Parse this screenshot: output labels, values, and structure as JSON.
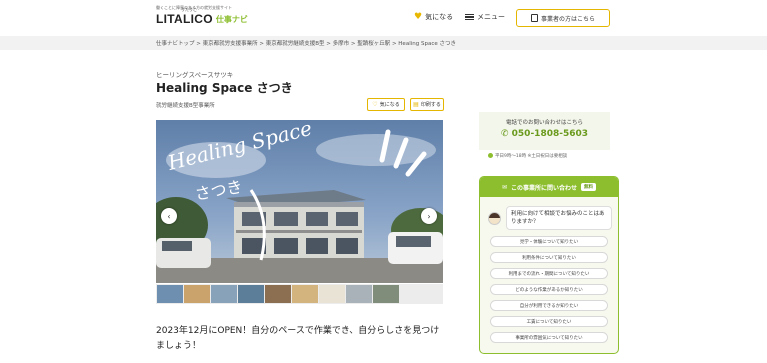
{
  "header": {
    "tagline": "働くことに障害のある方の就労支援サイト",
    "logo_main": "LITALICO",
    "logo_ruby": "りたりこ",
    "logo_sub": "仕事ナビ",
    "favorite_label": "気になる",
    "menu_label": "メニュー",
    "business_button": "事業者の方はこちら"
  },
  "breadcrumb": "仕事ナビトップ > 東京都就労支援事業所 > 東京都就労継続支援B型 > 多摩市 > 聖蹟桜ヶ丘駅 > Healing Space さつき",
  "facility": {
    "subtitle": "ヒーリングスペースサツキ",
    "name": "Healing Space さつき",
    "category": "就労継続支援B型事業所",
    "fav_button": "気になる",
    "print_button": "印刷する"
  },
  "photo": {
    "overlay_text_1": "Healing Space",
    "overlay_text_2": "さつき",
    "prev": "‹",
    "next": "›"
  },
  "lead": "2023年12月にOPEN！自分のペースで作業でき、自分らしさを見つけましょう！",
  "contact": {
    "phone_label": "電話でのお問い合わせはこちら",
    "phone_number": "050-1808-5603",
    "note": "平日9時〜18時 ※土日祝日は要相談"
  },
  "inquiry": {
    "title": "この事業所に問い合わせ",
    "badge": "無料",
    "question": "利用に向けて相談でお悩みのことはありますか？",
    "options": [
      "見学・体験について知りたい",
      "利用条件について知りたい",
      "利用までの流れ・期間について知りたい",
      "どのような作業があるか知りたい",
      "自分が利用できるか知りたい",
      "工賃について知りたい",
      "事業所の雰囲気について知りたい"
    ]
  },
  "colors": {
    "accent_green": "#8cbe2e",
    "accent_yellow": "#e5b600"
  }
}
